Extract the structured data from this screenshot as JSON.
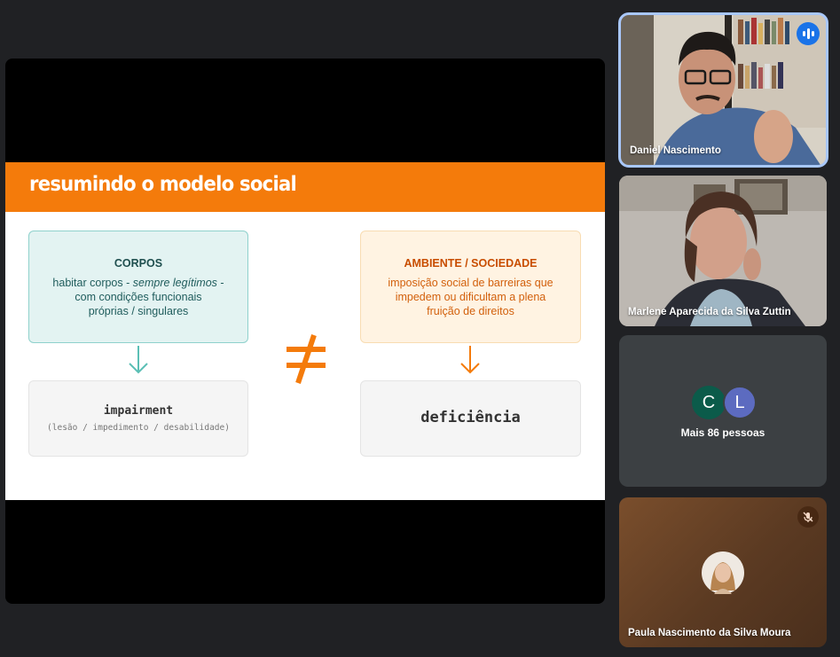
{
  "slide": {
    "title": "resumindo o modelo social",
    "corpos": {
      "heading": "CORPOS",
      "line1_prefix": "habitar corpos - ",
      "line1_italic": "sempre legítimos",
      "line1_suffix": " -",
      "line2": "com condições funcionais",
      "line3": "próprias / singulares"
    },
    "ambiente": {
      "heading": "AMBIENTE / SOCIEDADE",
      "line1": "imposição social de barreiras que",
      "line2": "impedem ou dificultam a plena",
      "line3": "fruição de direitos"
    },
    "impairment": {
      "term": "impairment",
      "note": "(lesão / impedimento / desabilidade)"
    },
    "deficiencia": {
      "term": "deficiência"
    },
    "neq_symbol": "≠"
  },
  "participants": [
    {
      "name": "Daniel Nascimento",
      "speaking": true
    },
    {
      "name": "Marlene Aparecida da Silva Zuttin",
      "speaking": false
    },
    {
      "name": "Paula Nascimento da Silva Moura",
      "muted": true
    }
  ],
  "overflow": {
    "avatar_c": "C",
    "avatar_l": "L",
    "label": "Mais 86 pessoas"
  },
  "colors": {
    "background": "#202124",
    "accent_orange": "#f47b0b",
    "teal": "#5bbfb5",
    "speaking_border": "#a8c7fa"
  }
}
